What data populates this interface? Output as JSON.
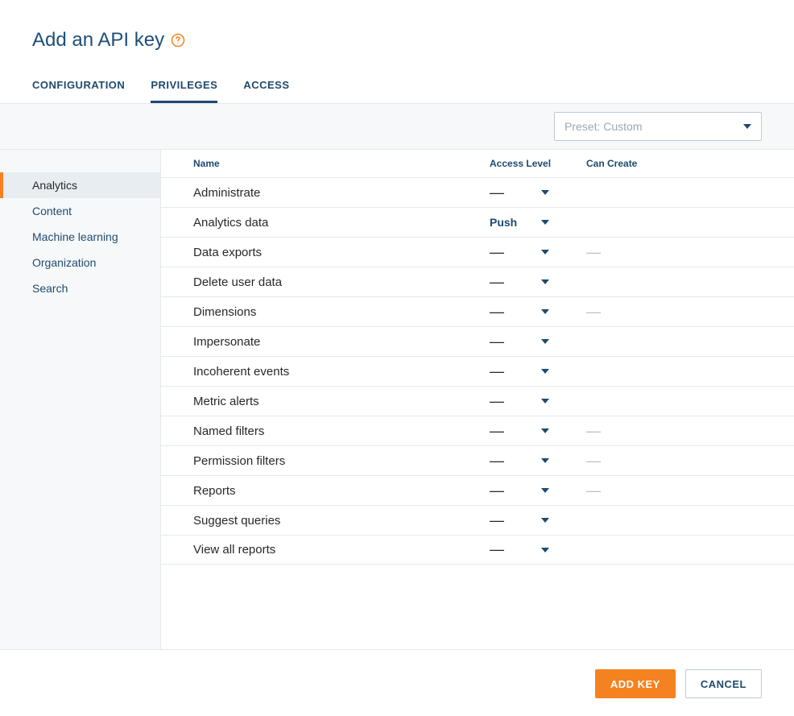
{
  "page": {
    "title": "Add an API key"
  },
  "tabs": [
    {
      "label": "CONFIGURATION",
      "active": false
    },
    {
      "label": "PRIVILEGES",
      "active": true
    },
    {
      "label": "ACCESS",
      "active": false
    }
  ],
  "preset": {
    "label": "Preset:",
    "value": "Custom"
  },
  "sidebar": {
    "items": [
      {
        "label": "Analytics",
        "active": true
      },
      {
        "label": "Content",
        "active": false
      },
      {
        "label": "Machine learning",
        "active": false
      },
      {
        "label": "Organization",
        "active": false
      },
      {
        "label": "Search",
        "active": false
      }
    ]
  },
  "table": {
    "headers": {
      "name": "Name",
      "access": "Access Level",
      "create": "Can Create"
    },
    "rows": [
      {
        "name": "Administrate",
        "access": "—",
        "can_create": ""
      },
      {
        "name": "Analytics data",
        "access": "Push",
        "can_create": ""
      },
      {
        "name": "Data exports",
        "access": "—",
        "can_create": "—"
      },
      {
        "name": "Delete user data",
        "access": "—",
        "can_create": ""
      },
      {
        "name": "Dimensions",
        "access": "—",
        "can_create": "—"
      },
      {
        "name": "Impersonate",
        "access": "—",
        "can_create": ""
      },
      {
        "name": "Incoherent events",
        "access": "—",
        "can_create": ""
      },
      {
        "name": "Metric alerts",
        "access": "—",
        "can_create": ""
      },
      {
        "name": "Named filters",
        "access": "—",
        "can_create": "—"
      },
      {
        "name": "Permission filters",
        "access": "—",
        "can_create": "—"
      },
      {
        "name": "Reports",
        "access": "—",
        "can_create": "—"
      },
      {
        "name": "Suggest queries",
        "access": "—",
        "can_create": ""
      },
      {
        "name": "View all reports",
        "access": "—",
        "can_create": ""
      }
    ]
  },
  "footer": {
    "primary": "ADD KEY",
    "secondary": "CANCEL"
  }
}
